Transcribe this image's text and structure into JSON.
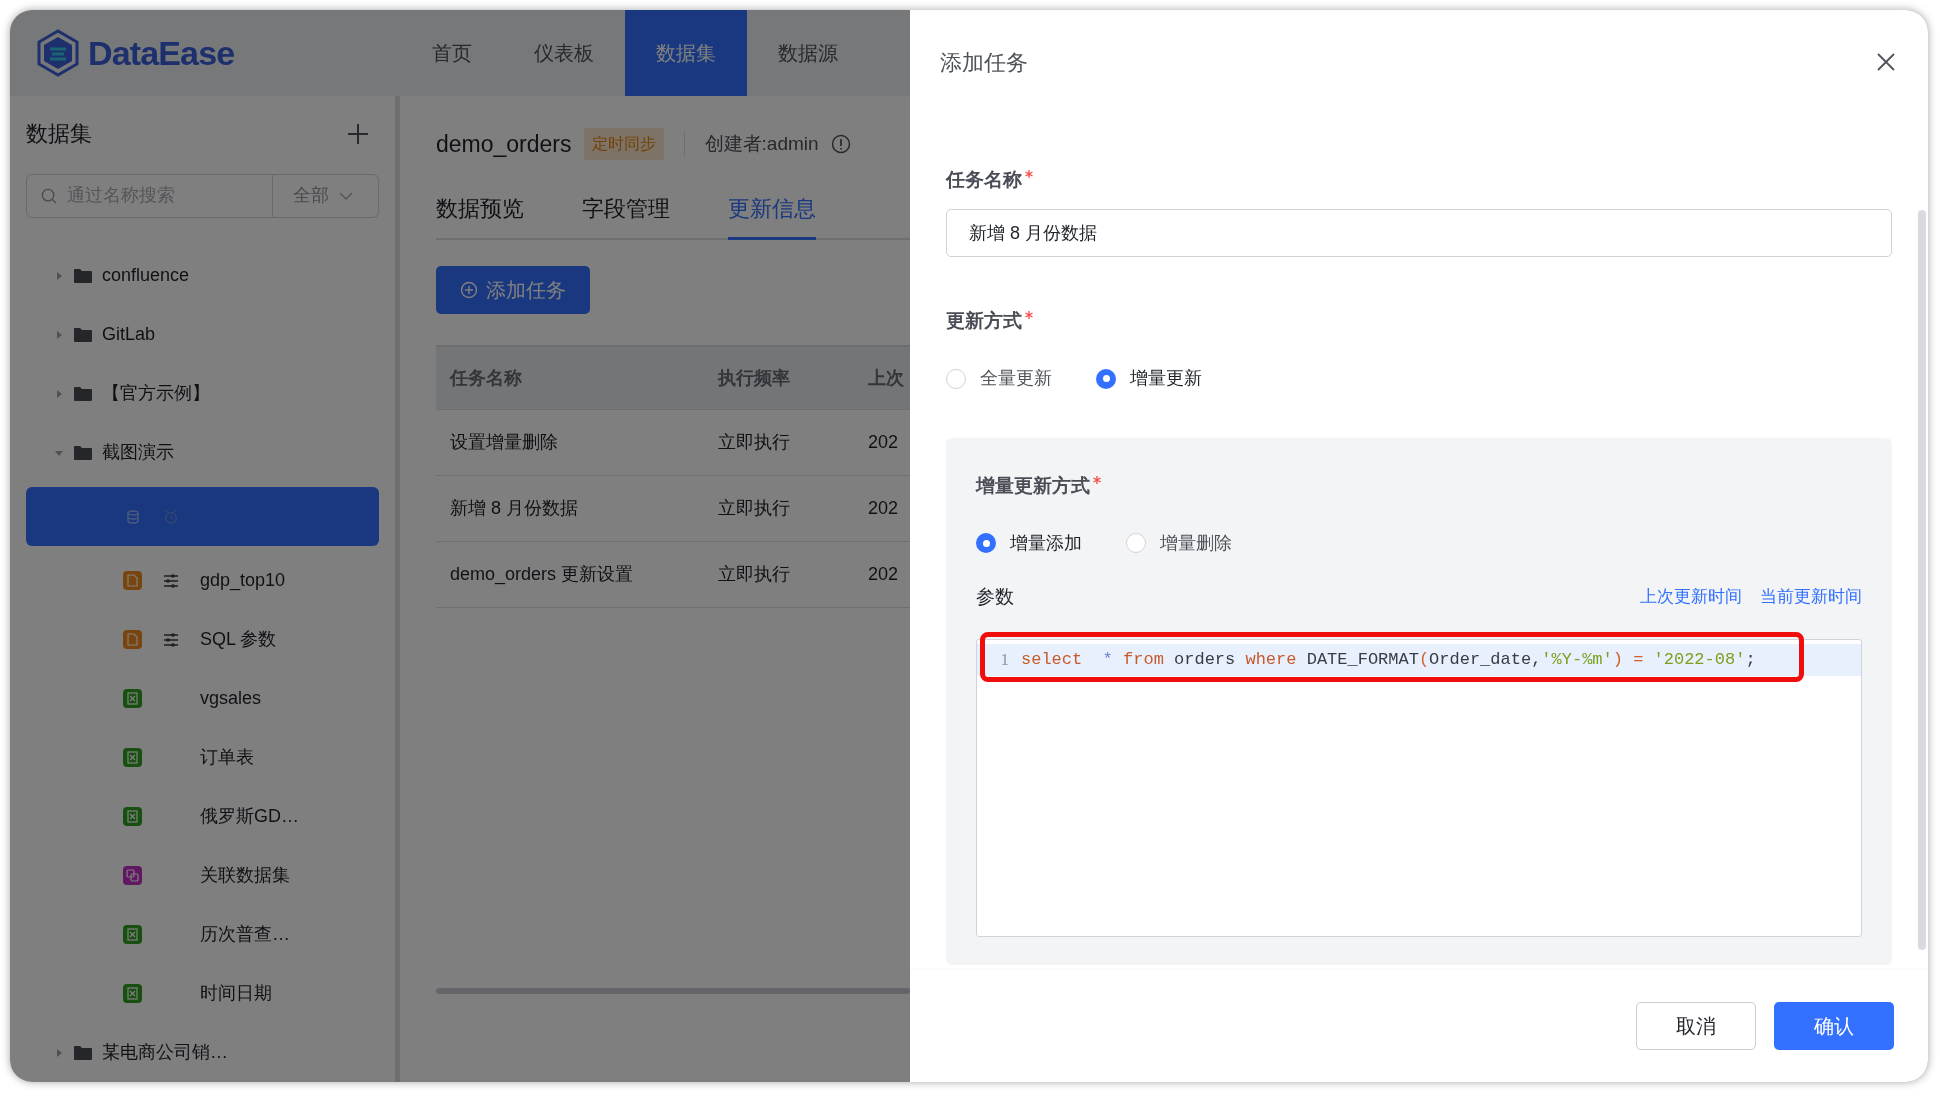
{
  "app": {
    "logo": "DataEase"
  },
  "nav": [
    {
      "label": "首页",
      "selected": false
    },
    {
      "label": "仪表板",
      "selected": false
    },
    {
      "label": "数据集",
      "selected": true
    },
    {
      "label": "数据源",
      "selected": false
    }
  ],
  "sidebar": {
    "title": "数据集",
    "search": {
      "placeholder": "通过名称搜索"
    },
    "filter": "全部",
    "tree": [
      {
        "name": "confluence",
        "kind": "folder",
        "expanded": false,
        "selected": false
      },
      {
        "name": "GitLab",
        "kind": "folder",
        "expanded": false,
        "selected": false
      },
      {
        "name": "【官方示例】",
        "kind": "folder",
        "expanded": false,
        "selected": false
      },
      {
        "name": "截图演示",
        "kind": "folder",
        "expanded": true,
        "selected": false,
        "children": [
          {
            "kind": "db",
            "selected": true
          },
          {
            "name": "gdp_top10",
            "kind": "sql",
            "selected": false
          },
          {
            "name": "SQL 参数",
            "kind": "sql",
            "selected": false
          },
          {
            "name": "vgsales",
            "kind": "excel",
            "selected": false
          },
          {
            "name": "订单表",
            "kind": "excel",
            "selected": false
          },
          {
            "name": "俄罗斯GD…",
            "kind": "excel",
            "selected": false
          },
          {
            "name": "关联数据集",
            "kind": "union",
            "selected": false
          },
          {
            "name": "历次普查…",
            "kind": "excel",
            "selected": false
          },
          {
            "name": "时间日期",
            "kind": "excel",
            "selected": false
          }
        ]
      },
      {
        "name": "某电商公司销…",
        "kind": "folder",
        "expanded": false,
        "selected": false
      }
    ]
  },
  "dataset": {
    "title": "demo_orders",
    "tag": "定时同步",
    "creator": "创建者:admin",
    "tabs": [
      {
        "label": "数据预览",
        "selected": false
      },
      {
        "label": "字段管理",
        "selected": false
      },
      {
        "label": "更新信息",
        "selected": true
      }
    ],
    "add_button": "添加任务",
    "table": {
      "columns": [
        "任务名称",
        "执行频率",
        "上次"
      ],
      "rows": [
        [
          "设置增量删除",
          "立即执行",
          "202"
        ],
        [
          "新增 8 月份数据",
          "立即执行",
          "202"
        ],
        [
          "demo_orders 更新设置",
          "立即执行",
          "202"
        ]
      ]
    }
  },
  "drawer": {
    "title": "添加任务",
    "task_name": {
      "label": "任务名称",
      "required": true,
      "value": "新增 8 月份数据"
    },
    "update_mode": {
      "label": "更新方式",
      "required": true,
      "options": [
        {
          "label": "全量更新",
          "selected": false
        },
        {
          "label": "增量更新",
          "selected": true
        }
      ]
    },
    "incremental": {
      "label": "增量更新方式",
      "required": true,
      "options": [
        {
          "label": "增量添加",
          "selected": true
        },
        {
          "label": "增量删除",
          "selected": false
        }
      ],
      "params_label": "参数",
      "links": [
        "上次更新时间",
        "当前更新时间"
      ],
      "code": [
        {
          "number": "1",
          "highlighted": true,
          "tokens": [
            {
              "text": "select",
              "kind": "keyword"
            },
            {
              "text": "  *",
              "kind": "operator"
            },
            {
              "text": " from",
              "kind": "keyword"
            },
            {
              "text": " orders ",
              "kind": "plain"
            },
            {
              "text": "where",
              "kind": "keyword"
            },
            {
              "text": " DATE_FORMAT",
              "kind": "plain"
            },
            {
              "text": "(",
              "kind": "bracket"
            },
            {
              "text": "Order_date,",
              "kind": "plain"
            },
            {
              "text": "'%Y-%m'",
              "kind": "string"
            },
            {
              "text": ")",
              "kind": "bracket"
            },
            {
              "text": " =",
              "kind": "bracket"
            },
            {
              "text": " '2022-08'",
              "kind": "string"
            },
            {
              "text": ";",
              "kind": "plain"
            }
          ]
        }
      ]
    },
    "buttons": [
      {
        "label": "取消",
        "kind": "secondary"
      },
      {
        "label": "确认",
        "kind": "primary"
      }
    ]
  }
}
